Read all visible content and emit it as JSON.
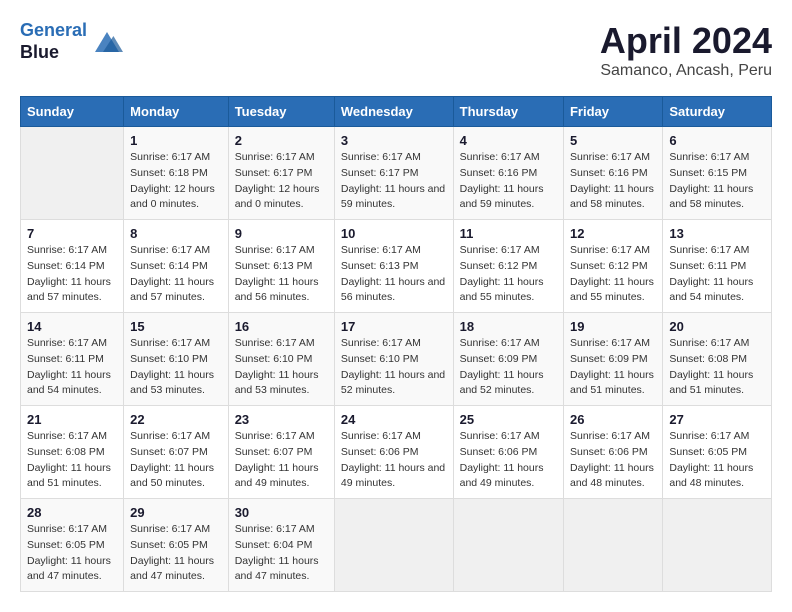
{
  "header": {
    "logo_line1": "General",
    "logo_line2": "Blue",
    "month": "April 2024",
    "location": "Samanco, Ancash, Peru"
  },
  "weekdays": [
    "Sunday",
    "Monday",
    "Tuesday",
    "Wednesday",
    "Thursday",
    "Friday",
    "Saturday"
  ],
  "weeks": [
    [
      {
        "day": "",
        "empty": true
      },
      {
        "day": "1",
        "sunrise": "6:17 AM",
        "sunset": "6:18 PM",
        "daylight": "12 hours and 0 minutes."
      },
      {
        "day": "2",
        "sunrise": "6:17 AM",
        "sunset": "6:17 PM",
        "daylight": "12 hours and 0 minutes."
      },
      {
        "day": "3",
        "sunrise": "6:17 AM",
        "sunset": "6:17 PM",
        "daylight": "11 hours and 59 minutes."
      },
      {
        "day": "4",
        "sunrise": "6:17 AM",
        "sunset": "6:16 PM",
        "daylight": "11 hours and 59 minutes."
      },
      {
        "day": "5",
        "sunrise": "6:17 AM",
        "sunset": "6:16 PM",
        "daylight": "11 hours and 58 minutes."
      },
      {
        "day": "6",
        "sunrise": "6:17 AM",
        "sunset": "6:15 PM",
        "daylight": "11 hours and 58 minutes."
      }
    ],
    [
      {
        "day": "7",
        "sunrise": "6:17 AM",
        "sunset": "6:14 PM",
        "daylight": "11 hours and 57 minutes."
      },
      {
        "day": "8",
        "sunrise": "6:17 AM",
        "sunset": "6:14 PM",
        "daylight": "11 hours and 57 minutes."
      },
      {
        "day": "9",
        "sunrise": "6:17 AM",
        "sunset": "6:13 PM",
        "daylight": "11 hours and 56 minutes."
      },
      {
        "day": "10",
        "sunrise": "6:17 AM",
        "sunset": "6:13 PM",
        "daylight": "11 hours and 56 minutes."
      },
      {
        "day": "11",
        "sunrise": "6:17 AM",
        "sunset": "6:12 PM",
        "daylight": "11 hours and 55 minutes."
      },
      {
        "day": "12",
        "sunrise": "6:17 AM",
        "sunset": "6:12 PM",
        "daylight": "11 hours and 55 minutes."
      },
      {
        "day": "13",
        "sunrise": "6:17 AM",
        "sunset": "6:11 PM",
        "daylight": "11 hours and 54 minutes."
      }
    ],
    [
      {
        "day": "14",
        "sunrise": "6:17 AM",
        "sunset": "6:11 PM",
        "daylight": "11 hours and 54 minutes."
      },
      {
        "day": "15",
        "sunrise": "6:17 AM",
        "sunset": "6:10 PM",
        "daylight": "11 hours and 53 minutes."
      },
      {
        "day": "16",
        "sunrise": "6:17 AM",
        "sunset": "6:10 PM",
        "daylight": "11 hours and 53 minutes."
      },
      {
        "day": "17",
        "sunrise": "6:17 AM",
        "sunset": "6:10 PM",
        "daylight": "11 hours and 52 minutes."
      },
      {
        "day": "18",
        "sunrise": "6:17 AM",
        "sunset": "6:09 PM",
        "daylight": "11 hours and 52 minutes."
      },
      {
        "day": "19",
        "sunrise": "6:17 AM",
        "sunset": "6:09 PM",
        "daylight": "11 hours and 51 minutes."
      },
      {
        "day": "20",
        "sunrise": "6:17 AM",
        "sunset": "6:08 PM",
        "daylight": "11 hours and 51 minutes."
      }
    ],
    [
      {
        "day": "21",
        "sunrise": "6:17 AM",
        "sunset": "6:08 PM",
        "daylight": "11 hours and 51 minutes."
      },
      {
        "day": "22",
        "sunrise": "6:17 AM",
        "sunset": "6:07 PM",
        "daylight": "11 hours and 50 minutes."
      },
      {
        "day": "23",
        "sunrise": "6:17 AM",
        "sunset": "6:07 PM",
        "daylight": "11 hours and 49 minutes."
      },
      {
        "day": "24",
        "sunrise": "6:17 AM",
        "sunset": "6:06 PM",
        "daylight": "11 hours and 49 minutes."
      },
      {
        "day": "25",
        "sunrise": "6:17 AM",
        "sunset": "6:06 PM",
        "daylight": "11 hours and 49 minutes."
      },
      {
        "day": "26",
        "sunrise": "6:17 AM",
        "sunset": "6:06 PM",
        "daylight": "11 hours and 48 minutes."
      },
      {
        "day": "27",
        "sunrise": "6:17 AM",
        "sunset": "6:05 PM",
        "daylight": "11 hours and 48 minutes."
      }
    ],
    [
      {
        "day": "28",
        "sunrise": "6:17 AM",
        "sunset": "6:05 PM",
        "daylight": "11 hours and 47 minutes."
      },
      {
        "day": "29",
        "sunrise": "6:17 AM",
        "sunset": "6:05 PM",
        "daylight": "11 hours and 47 minutes."
      },
      {
        "day": "30",
        "sunrise": "6:17 AM",
        "sunset": "6:04 PM",
        "daylight": "11 hours and 47 minutes."
      },
      {
        "day": "",
        "empty": true
      },
      {
        "day": "",
        "empty": true
      },
      {
        "day": "",
        "empty": true
      },
      {
        "day": "",
        "empty": true
      }
    ]
  ],
  "labels": {
    "sunrise": "Sunrise:",
    "sunset": "Sunset:",
    "daylight": "Daylight:"
  }
}
